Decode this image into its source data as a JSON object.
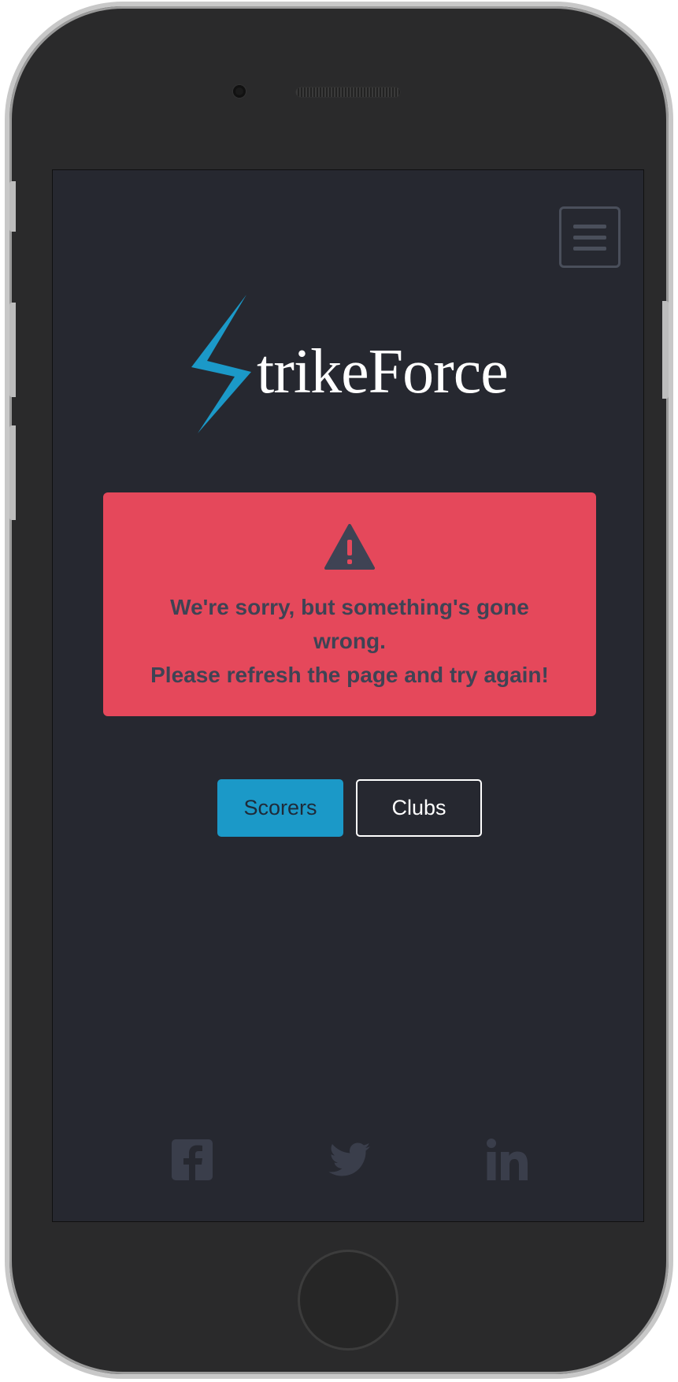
{
  "app": {
    "brand_text": "trikeForce",
    "brand_color": "#1b99c8"
  },
  "header": {
    "menu_icon": "hamburger-menu-icon"
  },
  "alert": {
    "icon": "warning-triangle-icon",
    "line1": "We're sorry, but something's gone wrong.",
    "line2": "Please refresh the page and try again!",
    "background": "#e5485b"
  },
  "nav_buttons": {
    "scorers_label": "Scorers",
    "clubs_label": "Clubs"
  },
  "footer": {
    "social": [
      "facebook-icon",
      "twitter-icon",
      "linkedin-icon"
    ]
  }
}
